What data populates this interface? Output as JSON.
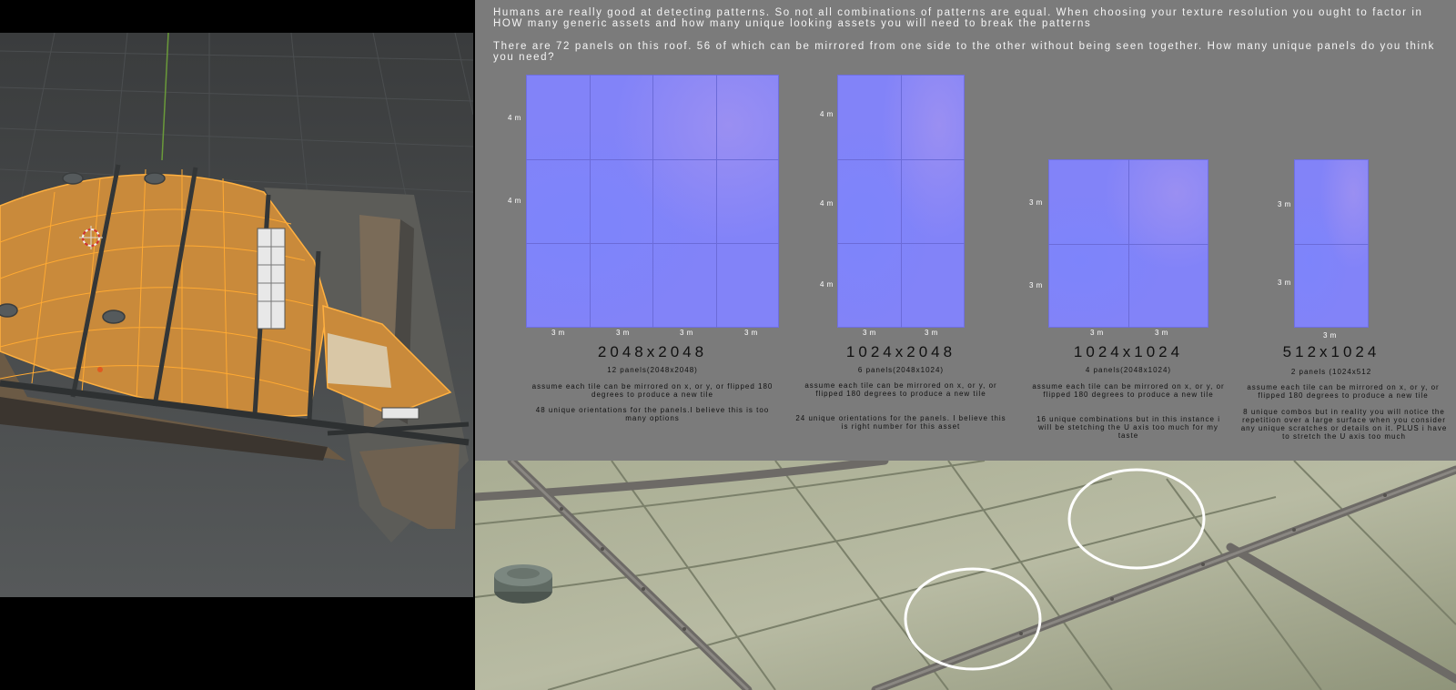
{
  "intro": {
    "p1": "Humans are really good at detecting patterns. So not all combinations of patterns are equal. When choosing your texture resolution you ought to factor in HOW many generic assets and how many unique looking assets you will need to break the patterns",
    "p2": "There are 72 panels on this roof. 56 of which can be mirrored from one side to the other without being seen together. How many unique panels do you think you need?"
  },
  "options": [
    {
      "resolution": "2048x2048",
      "panels": "12 panels(2048x2048)",
      "note1": "assume each tile can be mirrored on x, or y, or flipped 180 degrees to produce a new tile",
      "note2": "48 unique orientations for the panels.I believe this is too many options",
      "cols": 4,
      "rows": 3,
      "col_labels": [
        "3 m",
        "3 m",
        "3 m",
        "3 m"
      ],
      "row_labels": [
        "4 m",
        "4 m"
      ]
    },
    {
      "resolution": "1024x2048",
      "panels": "6 panels(2048x1024)",
      "note1": "assume each tile can be mirrored on x, or y, or flipped 180 degrees to produce a new tile",
      "note2": "24 unique orientations for the panels. I believe this is right number for this asset",
      "cols": 2,
      "rows": 3,
      "col_labels": [
        "3 m",
        "3 m"
      ],
      "row_labels": [
        "4 m",
        "4 m",
        "4 m"
      ]
    },
    {
      "resolution": "1024x1024",
      "panels": "4 panels(2048x1024)",
      "note1": "assume each tile can be mirrored on x, or y, or flipped 180 degrees to produce a new tile",
      "note2": "16 unique combinations but in this instance i will be stetching the U axis too much for my taste",
      "cols": 2,
      "rows": 2,
      "col_labels": [
        "3 m",
        "3 m"
      ],
      "row_labels": [
        "3 m",
        "3 m"
      ]
    },
    {
      "resolution": "512x1024",
      "panels": "2 panels (1024x512",
      "note1": "assume each tile can be mirrored on x, or y, or flipped 180 degrees to produce a new tile",
      "note2": "8 unique combos but in reality you will notice the repetition over a large surface when you consider any unique scratches or details on it. PLUS i have to stretch the U axis too much",
      "cols": 1,
      "rows": 2,
      "col_labels": [
        "3 m"
      ],
      "row_labels": [
        "3 m",
        "3 m"
      ]
    }
  ],
  "colors": {
    "normal_map": "#8283f8",
    "panel_bg": "#7b7b7b",
    "roof_orange": "#e8962a",
    "highlight_circle": "#ffffff"
  }
}
